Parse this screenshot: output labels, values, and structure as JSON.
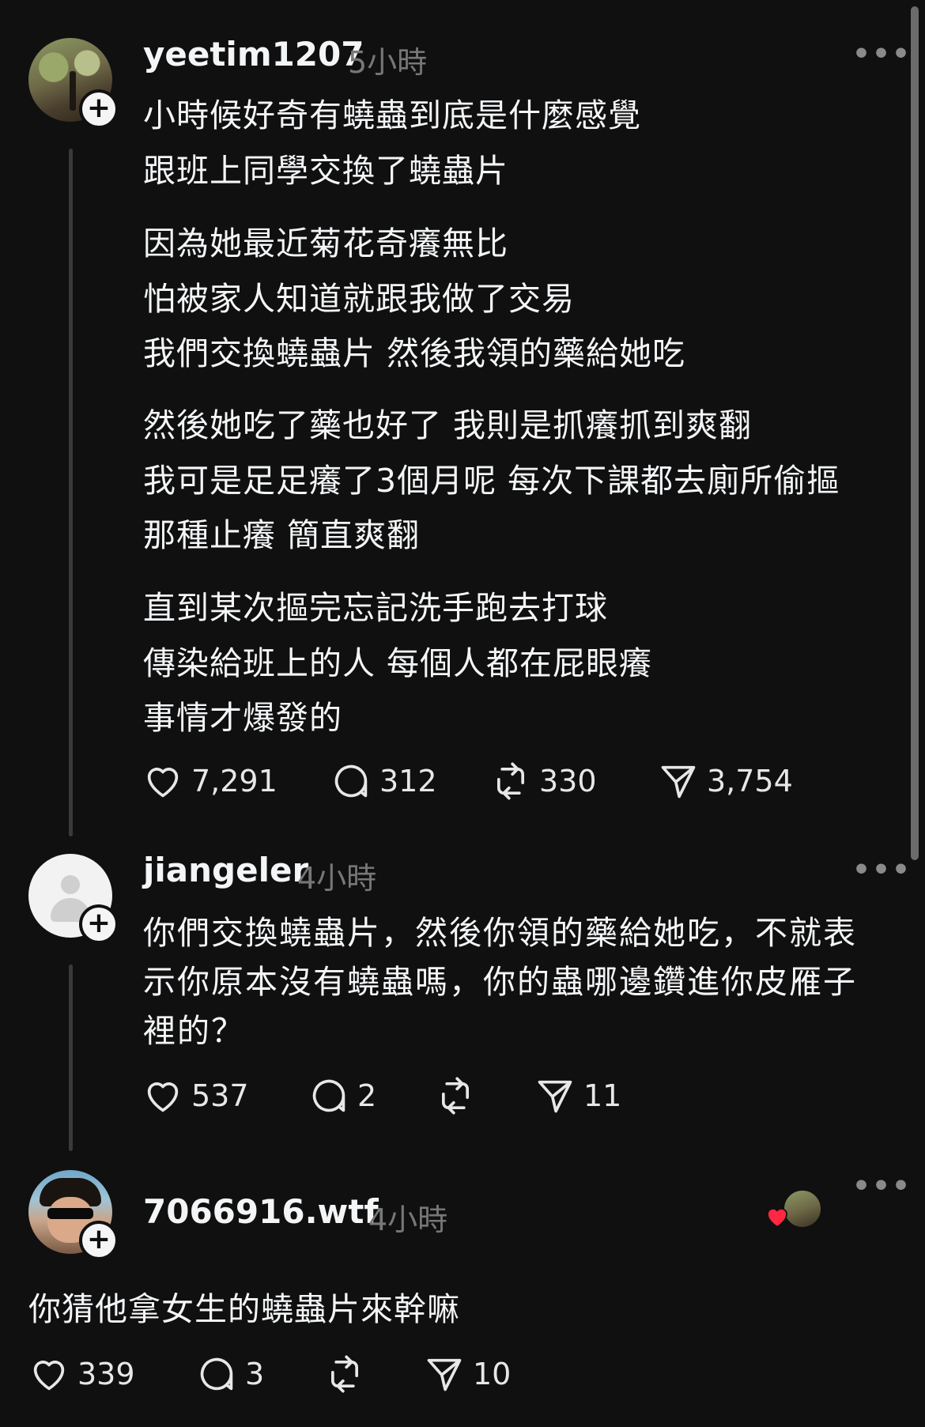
{
  "posts": [
    {
      "username": "yeetim1207",
      "time": "5小時",
      "lines": [
        "小時候好奇有蟯蟲到底是什麼感覺",
        "跟班上同學交換了蟯蟲片",
        "因為她最近菊花奇癢無比",
        "怕被家人知道就跟我做了交易",
        "我們交換蟯蟲片 然後我領的藥給她吃",
        "然後她吃了藥也好了 我則是抓癢抓到爽翻",
        "我可是足足癢了3個月呢 每次下課都去廁所偷摳",
        "那種止癢 簡直爽翻",
        "直到某次摳完忘記洗手跑去打球",
        "傳染給班上的人 每個人都在屁眼癢",
        "事情才爆發的"
      ],
      "likes": "7,291",
      "comments": "312",
      "reposts": "330",
      "shares": "3,754"
    },
    {
      "username": "jiangeler",
      "time": "4小時",
      "lines": [
        "你們交換蟯蟲片，然後你領的藥給她吃，不就表",
        "示你原本沒有蟯蟲嗎，你的蟲哪邊鑽進你皮雁子",
        "裡的？"
      ],
      "likes": "537",
      "comments": "2",
      "reposts": "",
      "shares": "11"
    },
    {
      "username": "7066916.wtf",
      "time": "4小時",
      "lines": [
        "你猜他拿女生的蟯蟲片來幹嘛"
      ],
      "likes": "339",
      "comments": "3",
      "reposts": "",
      "shares": "10"
    }
  ],
  "icons": {
    "like": "heart-icon",
    "comment": "comment-bubble-icon",
    "repost": "repost-icon",
    "share": "send-icon",
    "more": "more-dots-icon",
    "follow": "plus-icon"
  },
  "more_label": "•••",
  "plus_label": "+",
  "colors": {
    "background": "#101010",
    "text": "#f3f5f7",
    "muted": "#777777",
    "liked_heart": "#ff2742"
  }
}
